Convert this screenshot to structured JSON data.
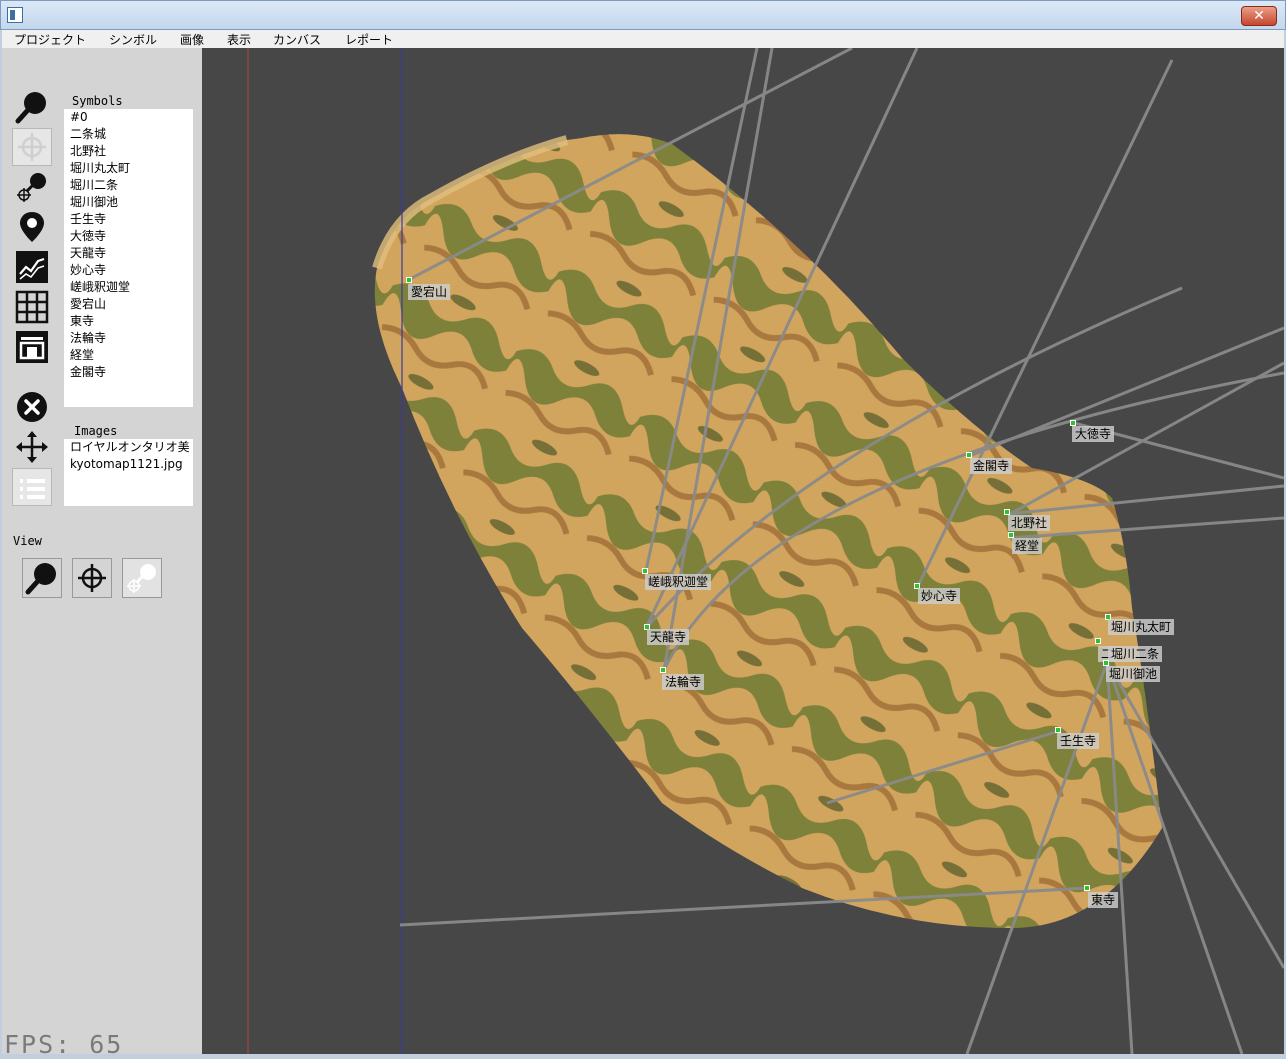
{
  "window": {
    "close_label": "✕"
  },
  "menu": [
    "プロジェクト",
    "シンボル",
    "画像",
    "表示",
    "カンバス",
    "レポート"
  ],
  "left": {
    "symbols_label": "Symbols",
    "symbols": [
      "#0",
      "二条城",
      "北野社",
      "堀川丸太町",
      "堀川二条",
      "堀川御池",
      "壬生寺",
      "大徳寺",
      "天龍寺",
      "妙心寺",
      "嵯峨釈迦堂",
      "愛宕山",
      "東寺",
      "法輪寺",
      "経堂",
      "金閣寺"
    ],
    "images_label": "Images",
    "images": [
      "ロイヤルオンタリオ美",
      "kyotomap1121.jpg"
    ],
    "view_label": "View",
    "tools": [
      "zoom-tool-icon",
      "crosshair-tool-icon",
      "zoom-crosshair-tool-icon",
      "map-pin-tool-icon",
      "line-chart-tool-icon",
      "grid-tool-icon",
      "layout-tool-icon",
      "delete-tool-icon",
      "move-tool-icon",
      "list-tool-icon"
    ]
  },
  "fps": "FPS: 65",
  "canvas": {
    "labels": {
      "atago": "愛宕山",
      "kinkaku": "金閣寺",
      "daitoku": "大徳寺",
      "kitano": "北野社",
      "kyodo": "経堂",
      "myoshin": "妙心寺",
      "saga": "嵯峨釈迦堂",
      "tenryu": "天龍寺",
      "horin": "法輪寺",
      "marutamachi": "堀川丸太町",
      "nijo": "二",
      "nijo_horikawa": "堀川二条",
      "oike": "堀川御池",
      "mibu": "壬生寺",
      "toji": "東寺"
    }
  },
  "colors": {
    "canvas_bg": "#474747",
    "marker": "#2cc32c",
    "line": "#8a8a8a",
    "map_tan": "#d2a55e",
    "map_green": "#6e7a34"
  }
}
